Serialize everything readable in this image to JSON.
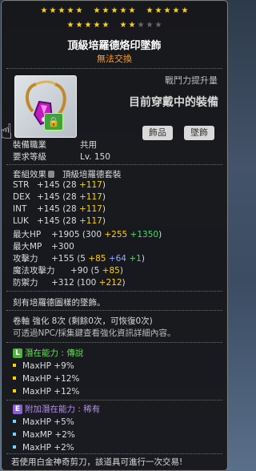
{
  "stars": {
    "row1": [
      5,
      5,
      5
    ],
    "row2": {
      "filled": [
        5,
        2
      ],
      "empty": 3
    }
  },
  "item": {
    "name": "頂級培羅德烙印墜飾",
    "trade": "無法交換"
  },
  "combat": {
    "label": "戰鬥力提升量",
    "current": "目前穿戴中的裝備"
  },
  "categories": [
    "飾品",
    "墜飾"
  ],
  "req": {
    "job_label": "裝備職業",
    "job_value": "共用",
    "level_label": "要求等級",
    "level_value": "Lv. 150"
  },
  "set": {
    "label": "套組效果",
    "value": "頂級培羅德套裝"
  },
  "stats": [
    {
      "name": "STR",
      "base": "+145",
      "paren_open": "(28 ",
      "bonus": "+117",
      "paren_close": ")"
    },
    {
      "name": "DEX",
      "base": "+145",
      "paren_open": "(28 ",
      "bonus": "+117",
      "paren_close": ")"
    },
    {
      "name": "INT",
      "base": "+145",
      "paren_open": "(28 ",
      "bonus": "+117",
      "paren_close": ")"
    },
    {
      "name": "LUK",
      "base": "+145",
      "paren_open": "(28 ",
      "bonus": "+117",
      "paren_close": ")"
    }
  ],
  "maxhp": {
    "name": "最大HP",
    "base": "+1905",
    "p_open": "(300 ",
    "b1": "+255",
    "b2": "+1350",
    "p_close": ")"
  },
  "maxmp": {
    "name": "最大MP",
    "base": "+300"
  },
  "atk": {
    "name": "攻擊力",
    "base": "+155",
    "p_open": "(5 ",
    "b1": "+85",
    "b2": "+64",
    "b3": "+1",
    "p_close": ")"
  },
  "matk": {
    "name": "魔法攻擊力",
    "base": "+90",
    "p_open": "(5 ",
    "b1": "+85",
    "p_close": ")"
  },
  "def": {
    "name": "防禦力",
    "base": "+312",
    "p_open": "(100 ",
    "b1": "+212",
    "p_close": ")"
  },
  "desc": "刻有培羅德圖樣的墜飾。",
  "enhance": {
    "line1": "卷軸 強化 8次 (剩餘0次，可恢復0次)",
    "line2": "可透過NPC/採集鍵查看強化資訊詳細內容。"
  },
  "potential": {
    "label": "潛在能力 : 傳說",
    "lines": [
      "MaxHP +9%",
      "MaxHP +12%",
      "MaxHP +12%"
    ]
  },
  "bonus_potential": {
    "label": "附加潛在能力 : 稀有",
    "lines": [
      "MaxHP +5%",
      "MaxMP +2%",
      "MaxHP +2%"
    ]
  },
  "footer": "若使用白金神奇剪刀，該道具可進行一次交易!",
  "colors": {
    "gold": "#ffd200",
    "green": "#4bdc64",
    "blue": "#8fa8ff",
    "orange": "#ff9d2a",
    "legendary": "#4db53a",
    "rare": "#8a5ed8"
  }
}
